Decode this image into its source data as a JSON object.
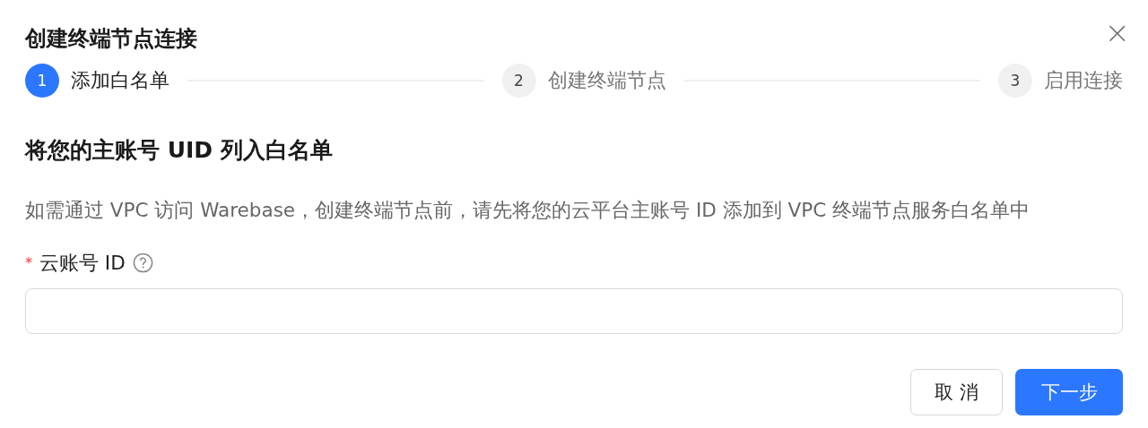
{
  "dialog": {
    "title": "创建终端节点连接",
    "close": "×"
  },
  "steps": [
    {
      "number": "1",
      "label": "添加白名单",
      "selected": true
    },
    {
      "number": "2",
      "label": "创建终端节点",
      "selected": false
    },
    {
      "number": "3",
      "label": "启用连接",
      "selected": false
    }
  ],
  "heading": "将您的主账号 UID 列入白名单",
  "description": "如需通过 VPC 访问 Warebase，创建终端节点前，请先将您的云平台主账号 ID 添加到 VPC 终端节点服务白名单中",
  "field": {
    "label": "云账号 ID",
    "required": true,
    "required_mark": "*"
  },
  "buttons": [
    {
      "label": "取 消",
      "kind": "secondary"
    },
    {
      "label": "下一步",
      "kind": "primary"
    }
  ]
}
